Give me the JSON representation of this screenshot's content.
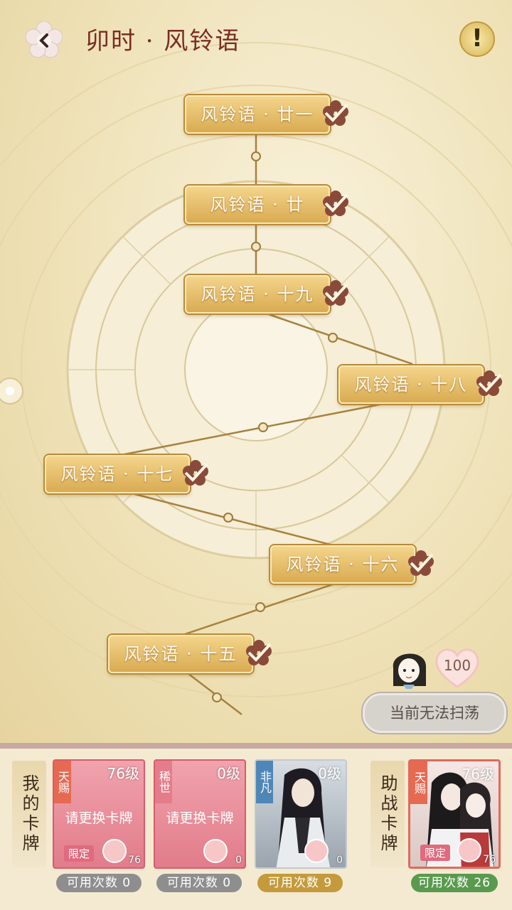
{
  "header": {
    "title": "卯时 · 风铃语",
    "info_label": "!"
  },
  "nodes": [
    {
      "label": "风铃语 · 廿一"
    },
    {
      "label": "风铃语 · 廿"
    },
    {
      "label": "风铃语 · 十九"
    },
    {
      "label": "风铃语 · 十八"
    },
    {
      "label": "风铃语 · 十七"
    },
    {
      "label": "风铃语 · 十六"
    },
    {
      "label": "风铃语 · 十五"
    }
  ],
  "stamina": {
    "value": "100"
  },
  "sweep_button": {
    "label": "当前无法扫荡"
  },
  "my_cards": {
    "label": "我的卡牌",
    "cards": [
      {
        "rarity": "天赐",
        "level": "76级",
        "message": "请更换卡牌",
        "limited": "限定",
        "number": "76",
        "uses": "可用次数 0"
      },
      {
        "rarity": "稀世",
        "level": "0级",
        "message": "请更换卡牌",
        "limited": "",
        "number": "0",
        "uses": "可用次数 0"
      },
      {
        "rarity": "非凡",
        "level": "0级",
        "message": "",
        "limited": "",
        "number": "0",
        "uses": "可用次数 9"
      }
    ]
  },
  "assist_cards": {
    "label": "助战卡牌",
    "cards": [
      {
        "rarity": "天赐",
        "level": "76级",
        "message": "",
        "limited": "限定",
        "number": "76",
        "uses": "可用次数 26"
      }
    ]
  },
  "colors": {
    "title": "#7a2d24",
    "node_gold": "#d9ab52",
    "uses_gray": "#8e8e8e",
    "uses_gold": "#c49a3c",
    "uses_green": "#5a9a4e"
  }
}
